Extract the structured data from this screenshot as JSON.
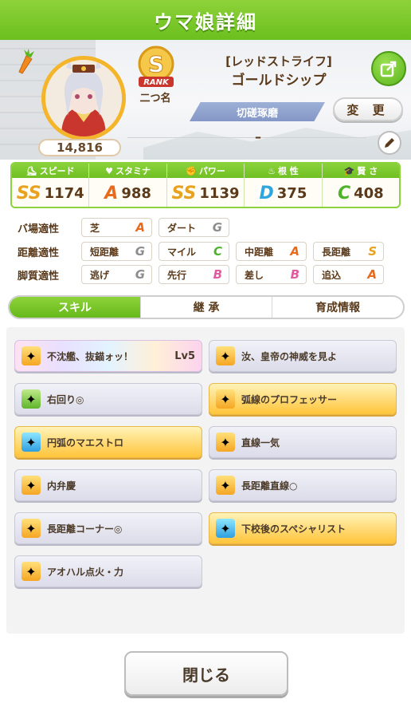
{
  "header": {
    "title": "ウマ娘詳細"
  },
  "profile": {
    "fans": "14,816",
    "rank_letter": "S",
    "rank_label": "RANK",
    "rank_sub": "二つ名",
    "nickname": "[レッドストライフ]",
    "name": "ゴールドシップ",
    "title_pill": "切磋琢磨",
    "change_label": "変 更",
    "subtitle_value": "–"
  },
  "stats": [
    {
      "label": "スピード",
      "icon": "shoe-icon",
      "grade": "SS",
      "value": "1174"
    },
    {
      "label": "スタミナ",
      "icon": "heart-icon",
      "grade": "A",
      "value": "988"
    },
    {
      "label": "パワー",
      "icon": "muscle-icon",
      "grade": "SS",
      "value": "1139"
    },
    {
      "label": "根 性",
      "icon": "flame-icon",
      "grade": "D",
      "value": "375"
    },
    {
      "label": "賢 さ",
      "icon": "graduation-cap-icon",
      "grade": "C",
      "value": "408"
    }
  ],
  "aptitudes": [
    {
      "label": "バ場適性",
      "items": [
        {
          "name": "芝",
          "grade": "A"
        },
        {
          "name": "ダート",
          "grade": "G"
        }
      ]
    },
    {
      "label": "距離適性",
      "items": [
        {
          "name": "短距離",
          "grade": "G"
        },
        {
          "name": "マイル",
          "grade": "C"
        },
        {
          "name": "中距離",
          "grade": "A"
        },
        {
          "name": "長距離",
          "grade": "S"
        }
      ]
    },
    {
      "label": "脚質適性",
      "items": [
        {
          "name": "逃げ",
          "grade": "G"
        },
        {
          "name": "先行",
          "grade": "B"
        },
        {
          "name": "差し",
          "grade": "B"
        },
        {
          "name": "追込",
          "grade": "A"
        }
      ]
    }
  ],
  "tabs": [
    {
      "label": "スキル",
      "active": true
    },
    {
      "label": "継 承",
      "active": false
    },
    {
      "label": "育成情報",
      "active": false
    }
  ],
  "skills": [
    {
      "name": "不沈艦、抜錨ォッ！",
      "level": "Lv5",
      "style": "rainbow",
      "icon": "orange"
    },
    {
      "name": "汝、皇帝の神威を見よ",
      "level": "",
      "style": "normal",
      "icon": "orange"
    },
    {
      "name": "右回り◎",
      "level": "",
      "style": "normal",
      "icon": "green"
    },
    {
      "name": "弧線のプロフェッサー",
      "level": "",
      "style": "gold",
      "icon": "orange"
    },
    {
      "name": "円弧のマエストロ",
      "level": "",
      "style": "gold",
      "icon": "blue"
    },
    {
      "name": "直線一気",
      "level": "",
      "style": "normal",
      "icon": "orange"
    },
    {
      "name": "内弁慶",
      "level": "",
      "style": "normal",
      "icon": "orange"
    },
    {
      "name": "長距離直線○",
      "level": "",
      "style": "normal",
      "icon": "orange"
    },
    {
      "name": "長距離コーナー◎",
      "level": "",
      "style": "normal",
      "icon": "orange"
    },
    {
      "name": "下校後のスペシャリスト",
      "level": "",
      "style": "gold",
      "icon": "blue"
    },
    {
      "name": "アオハル点火・力",
      "level": "",
      "style": "normal",
      "icon": "orange"
    }
  ],
  "footer": {
    "close_label": "閉じる"
  }
}
